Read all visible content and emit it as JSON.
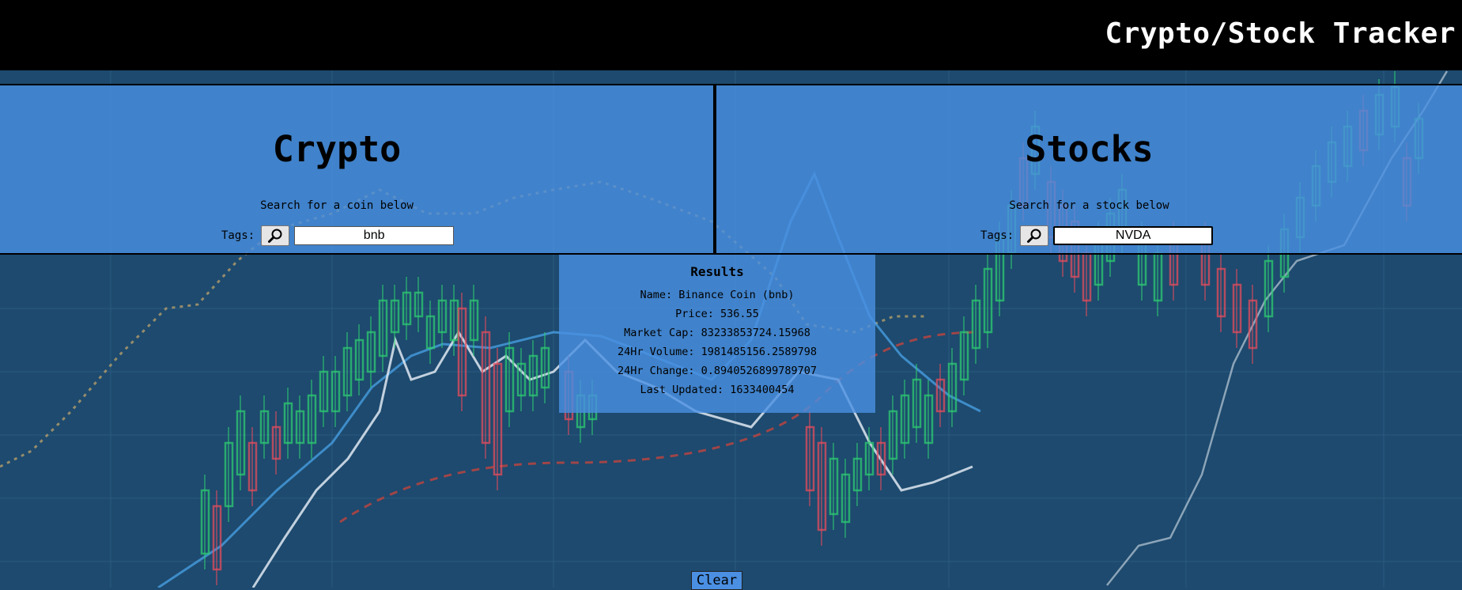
{
  "header": {
    "title": "Crypto/Stock Tracker"
  },
  "crypto": {
    "heading": "Crypto",
    "hint": "Search for a coin below",
    "tags_label": "Tags:",
    "search_value": "bnb"
  },
  "stocks": {
    "heading": "Stocks",
    "hint": "Search for a stock below",
    "tags_label": "Tags:",
    "search_value": "NVDA"
  },
  "results": {
    "heading": "Results",
    "name": "Name: Binance Coin (bnb)",
    "price": "Price: 536.55",
    "market_cap": "Market Cap: 83233853724.15968",
    "volume": "24Hr Volume: 1981485156.2589798",
    "change": "24Hr Change: 0.8940526899789707",
    "updated": "Last Updated: 1633400454"
  },
  "actions": {
    "clear_label": "Clear"
  },
  "icons": {
    "search": "magnifier-icon"
  },
  "colors": {
    "panel_blue": "#4a90e2",
    "header_black": "#000000",
    "background_navy": "#1d4a6e",
    "candle_green": "#2ecc71",
    "candle_red": "#e74c5c"
  }
}
